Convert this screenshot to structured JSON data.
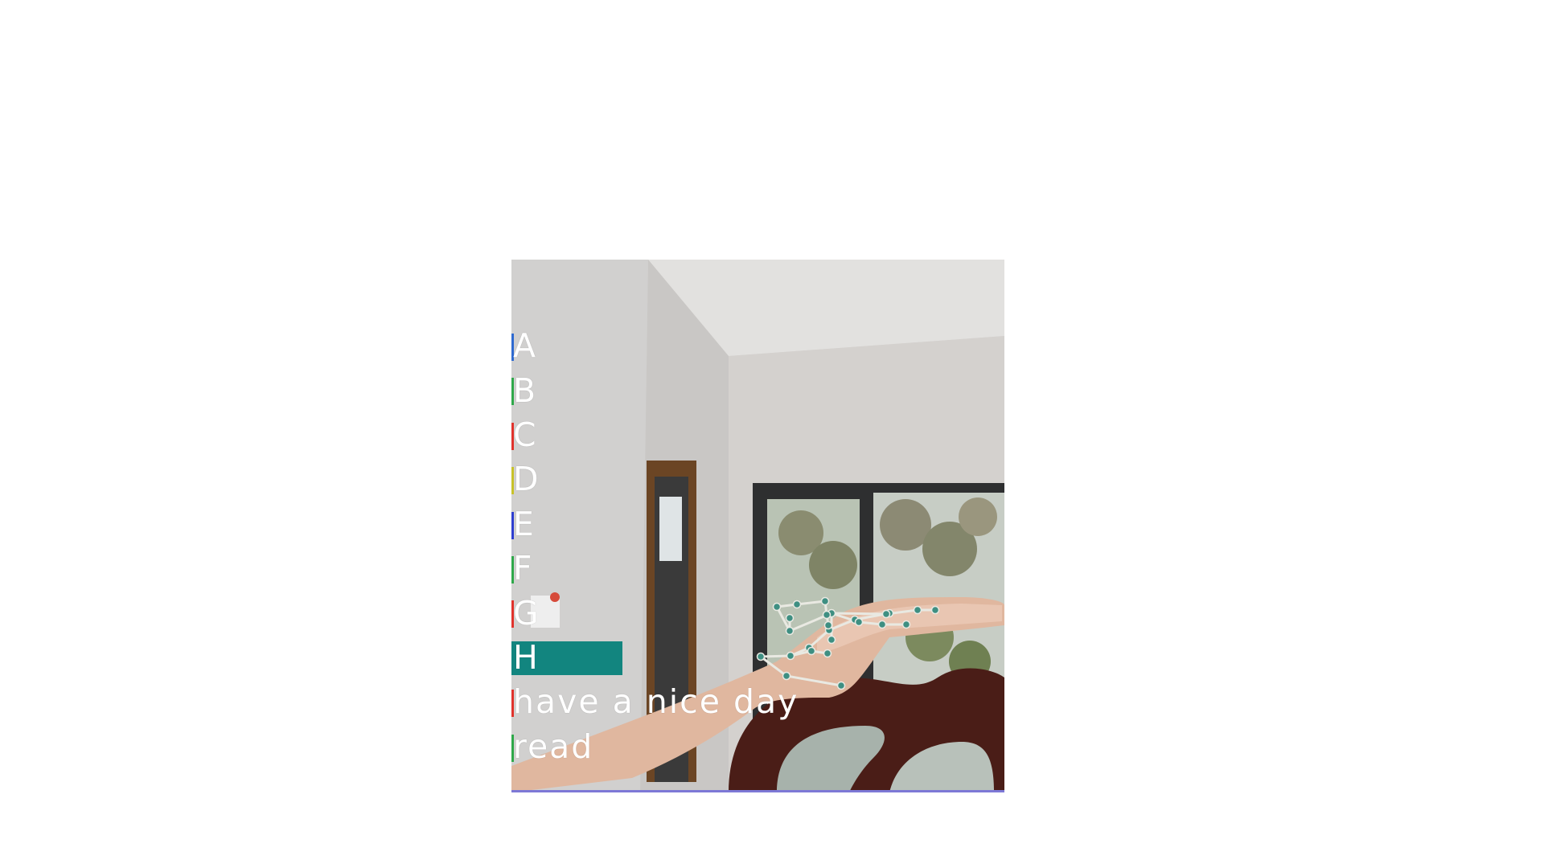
{
  "overlay": {
    "items": [
      {
        "label": "A",
        "marker_color": "#2f6ad0",
        "selected": false
      },
      {
        "label": "B",
        "marker_color": "#2fa84a",
        "selected": false
      },
      {
        "label": "C",
        "marker_color": "#e0332c",
        "selected": false
      },
      {
        "label": "D",
        "marker_color": "#c8c22a",
        "selected": false
      },
      {
        "label": "E",
        "marker_color": "#2f3fd0",
        "selected": false
      },
      {
        "label": "F",
        "marker_color": "#2fa84a",
        "selected": false
      },
      {
        "label": "G",
        "marker_color": "#e0332c",
        "selected": false
      },
      {
        "label": "H",
        "marker_color": "#12857f",
        "selected": true
      },
      {
        "label": "have a nice day",
        "marker_color": "#e0332c",
        "selected": false
      },
      {
        "label": "read",
        "marker_color": "#2fa84a",
        "selected": false
      }
    ],
    "highlight_color": "#12857f"
  },
  "hand_tracking": {
    "line_color": "#e9e9e2",
    "joint_color": "#3e8f82"
  }
}
